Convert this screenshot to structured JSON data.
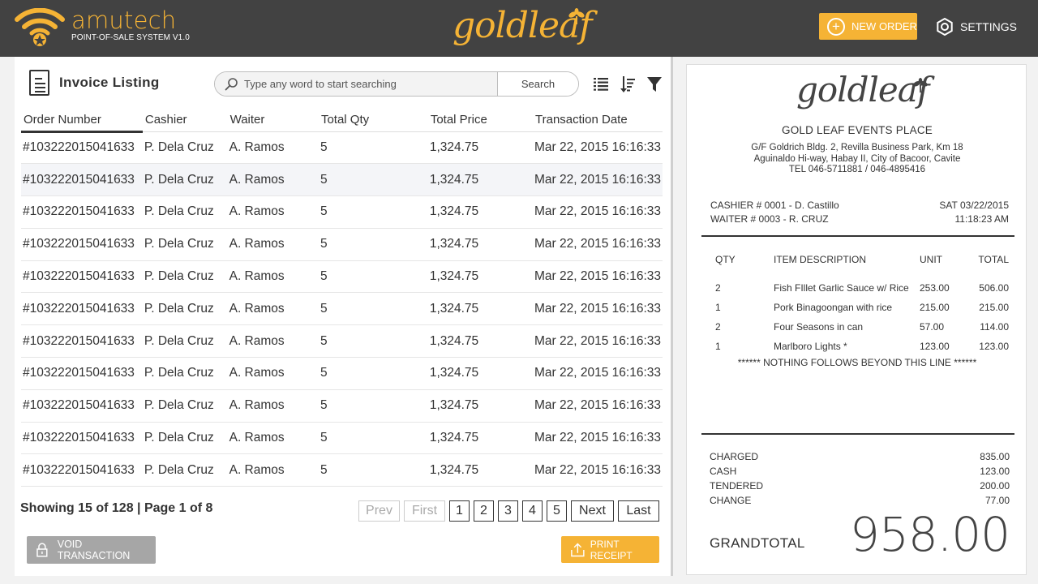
{
  "header": {
    "brand_name": "amutech",
    "brand_sub": "POINT-OF-SALE SYSTEM V1.0",
    "center_logo": "goldleaf",
    "new_order_label": "NEW ORDER",
    "settings_label": "SETTINGS",
    "accent_color": "#f5b335"
  },
  "invoice": {
    "title": "Invoice Listing",
    "search_placeholder": "Type any word to start searching",
    "search_button": "Search",
    "columns": [
      "Order Number",
      "Cashier",
      "Waiter",
      "Total Qty",
      "Total Price",
      "Transaction Date"
    ],
    "rows": [
      [
        "#103222015041633",
        "P. Dela Cruz",
        "A. Ramos",
        "5",
        "1,324.75",
        "Mar 22, 2015 16:16:33"
      ],
      [
        "#103222015041633",
        "P. Dela Cruz",
        "A. Ramos",
        "5",
        "1,324.75",
        "Mar 22, 2015 16:16:33"
      ],
      [
        "#103222015041633",
        "P. Dela Cruz",
        "A. Ramos",
        "5",
        "1,324.75",
        "Mar 22, 2015 16:16:33"
      ],
      [
        "#103222015041633",
        "P. Dela Cruz",
        "A. Ramos",
        "5",
        "1,324.75",
        "Mar 22, 2015 16:16:33"
      ],
      [
        "#103222015041633",
        "P. Dela Cruz",
        "A. Ramos",
        "5",
        "1,324.75",
        "Mar 22, 2015 16:16:33"
      ],
      [
        "#103222015041633",
        "P. Dela Cruz",
        "A. Ramos",
        "5",
        "1,324.75",
        "Mar 22, 2015 16:16:33"
      ],
      [
        "#103222015041633",
        "P. Dela Cruz",
        "A. Ramos",
        "5",
        "1,324.75",
        "Mar 22, 2015 16:16:33"
      ],
      [
        "#103222015041633",
        "P. Dela Cruz",
        "A. Ramos",
        "5",
        "1,324.75",
        "Mar 22, 2015 16:16:33"
      ],
      [
        "#103222015041633",
        "P. Dela Cruz",
        "A. Ramos",
        "5",
        "1,324.75",
        "Mar 22, 2015 16:16:33"
      ],
      [
        "#103222015041633",
        "P. Dela Cruz",
        "A. Ramos",
        "5",
        "1,324.75",
        "Mar 22, 2015 16:16:33"
      ],
      [
        "#103222015041633",
        "P. Dela Cruz",
        "A. Ramos",
        "5",
        "1,324.75",
        "Mar 22, 2015 16:16:33"
      ]
    ],
    "selected_row": 1,
    "showing_text": "Showing 15 of 128 | Page 1 of 8",
    "pager": [
      "Prev",
      "First",
      "1",
      "2",
      "3",
      "4",
      "5",
      "Next",
      "Last"
    ],
    "void_label": "VOID TRANSACTION",
    "print_label": "PRINT RECEIPT"
  },
  "receipt": {
    "logo": "goldleaf",
    "store_name": "GOLD LEAF EVENTS PLACE",
    "address1": "G/F Goldrich Bldg. 2, Revilla Business Park, Km 18",
    "address2": "Aguinaldo Hi-way, Habay II, City of Bacoor, Cavite",
    "tel": "TEL 046-5711881 / 046-4895416",
    "cashier": "CASHIER # 0001 - D. Castillo",
    "waiter": "WAITER # 0003 - R. CRUZ",
    "date": "SAT 03/22/2015",
    "time": "11:18:23 AM",
    "item_headers": [
      "QTY",
      "ITEM DESCRIPTION",
      "UNIT",
      "TOTAL"
    ],
    "items": [
      [
        "2",
        "Fish FIllet Garlic Sauce w/ Rice",
        "253.00",
        "506.00"
      ],
      [
        "1",
        "Pork Binagoongan with rice",
        "215.00",
        "215.00"
      ],
      [
        "2",
        "Four Seasons in can",
        "57.00",
        "114.00"
      ],
      [
        "1",
        "Marlboro Lights *",
        "123.00",
        "123.00"
      ]
    ],
    "nothing_follows": "****** NOTHING FOLLOWS BEYOND THIS LINE ******",
    "totals": [
      [
        "CHARGED",
        "835.00"
      ],
      [
        "CASH",
        "123.00"
      ],
      [
        "TENDERED",
        "200.00"
      ],
      [
        "CHANGE",
        "77.00"
      ]
    ],
    "grand_label": "GRANDTOTAL",
    "grand_value": "958.00"
  }
}
